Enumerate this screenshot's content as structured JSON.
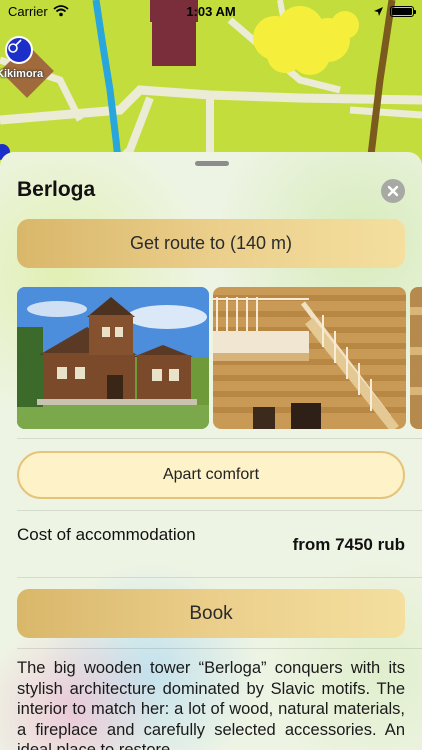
{
  "status_bar": {
    "carrier": "Carrier",
    "time": "1:03 AM",
    "icons": [
      "wifi-icon",
      "location-arrow-icon",
      "battery-icon"
    ]
  },
  "map": {
    "marker_label": "Kikimora",
    "marker_icon": "guitar-icon"
  },
  "sheet": {
    "title": "Berloga",
    "close_icon": "close-icon",
    "route_button": "Get route to (140 m)",
    "gallery": {
      "photos": [
        "wooden-tower-exterior-photo",
        "wooden-staircase-interior-photo",
        "interior-photo-partial"
      ]
    },
    "option_button": "Apart comfort",
    "cost_label": "Cost of accommodation",
    "cost_value": "from 7450 rub",
    "book_button": "Book",
    "description": "The big wooden tower “Berloga” conquers with its stylish architecture dominated by Slavic motifs. The interior to match her: a lot of wood, natural materials, a fireplace and carefully selected accessories. An ideal place to restore"
  },
  "colors": {
    "accent_gold": "#e6c47a",
    "option_fill": "#fdf2c8",
    "map_green": "#c3de3c"
  }
}
